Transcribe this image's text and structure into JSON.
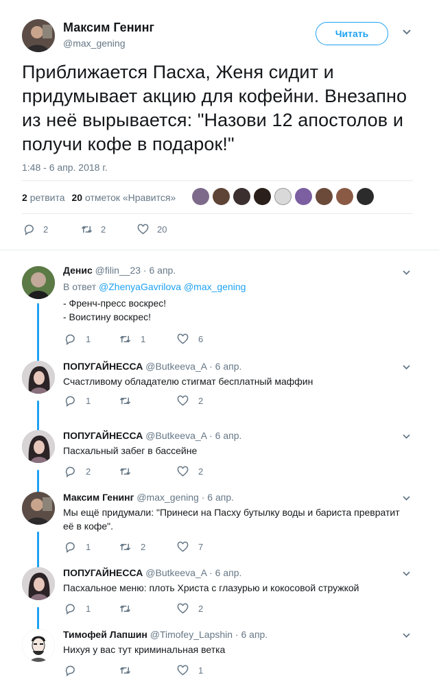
{
  "main": {
    "name": "Максим Генинг",
    "handle": "@max_gening",
    "follow_label": "Читать",
    "text": "Приближается Пасха, Женя сидит и придумывает акцию для кофейни. Внезапно из неё вырывается: \"Назови 12 апостолов и получи кофе в подарок!\"",
    "time": "1:48 - 6 апр. 2018 г.",
    "retweets_count": "2",
    "retweets_label": "ретвита",
    "likes_count": "20",
    "likes_label": "отметок «Нравится»",
    "actions": {
      "reply": "2",
      "retweet": "2",
      "like": "20"
    }
  },
  "replies": [
    {
      "name": "Денис",
      "handle": "@filin__23 · 6 апр.",
      "in_reply_prefix": "В ответ",
      "in_reply_to": "@ZhenyaGavrilova @max_gening",
      "lines": [
        "- Френч-пресс воскрес!",
        "- Воистину воскрес!"
      ],
      "reply": "1",
      "retweet": "1",
      "like": "6"
    },
    {
      "name": "ПОПУГАЙНЕССА",
      "handle": "@Butkeeva_A · 6 апр.",
      "lines": [
        "Счастливому обладателю стигмат бесплатный маффин"
      ],
      "reply": "1",
      "retweet": "",
      "like": "2"
    },
    {
      "name": "ПОПУГАЙНЕССА",
      "handle": "@Butkeeva_A · 6 апр.",
      "lines": [
        "Пасхальный забег в бассейне"
      ],
      "reply": "2",
      "retweet": "",
      "like": "2"
    },
    {
      "name": "Максим Генинг",
      "handle": "@max_gening · 6 апр.",
      "lines": [
        "Мы ещё придумали: \"Принеси на Пасху бутылку воды и бариста превратит",
        "её в кофе\"."
      ],
      "reply": "1",
      "retweet": "2",
      "like": "7"
    },
    {
      "name": "ПОПУГАЙНЕССА",
      "handle": "@Butkeeva_A · 6 апр.",
      "lines": [
        "Пасхальное меню: плоть Христа с глазурью и кокосовой стружкой"
      ],
      "reply": "1",
      "retweet": "",
      "like": "2"
    },
    {
      "name": "Тимофей Лапшин",
      "handle": "@Timofey_Lapshin · 6 апр.",
      "lines": [
        "Нихуя у вас тут криминальная ветка"
      ],
      "reply": "",
      "retweet": "",
      "like": "1"
    }
  ],
  "colors": {
    "accent": "#1da1f2",
    "muted": "#657786",
    "text": "#14171a"
  }
}
